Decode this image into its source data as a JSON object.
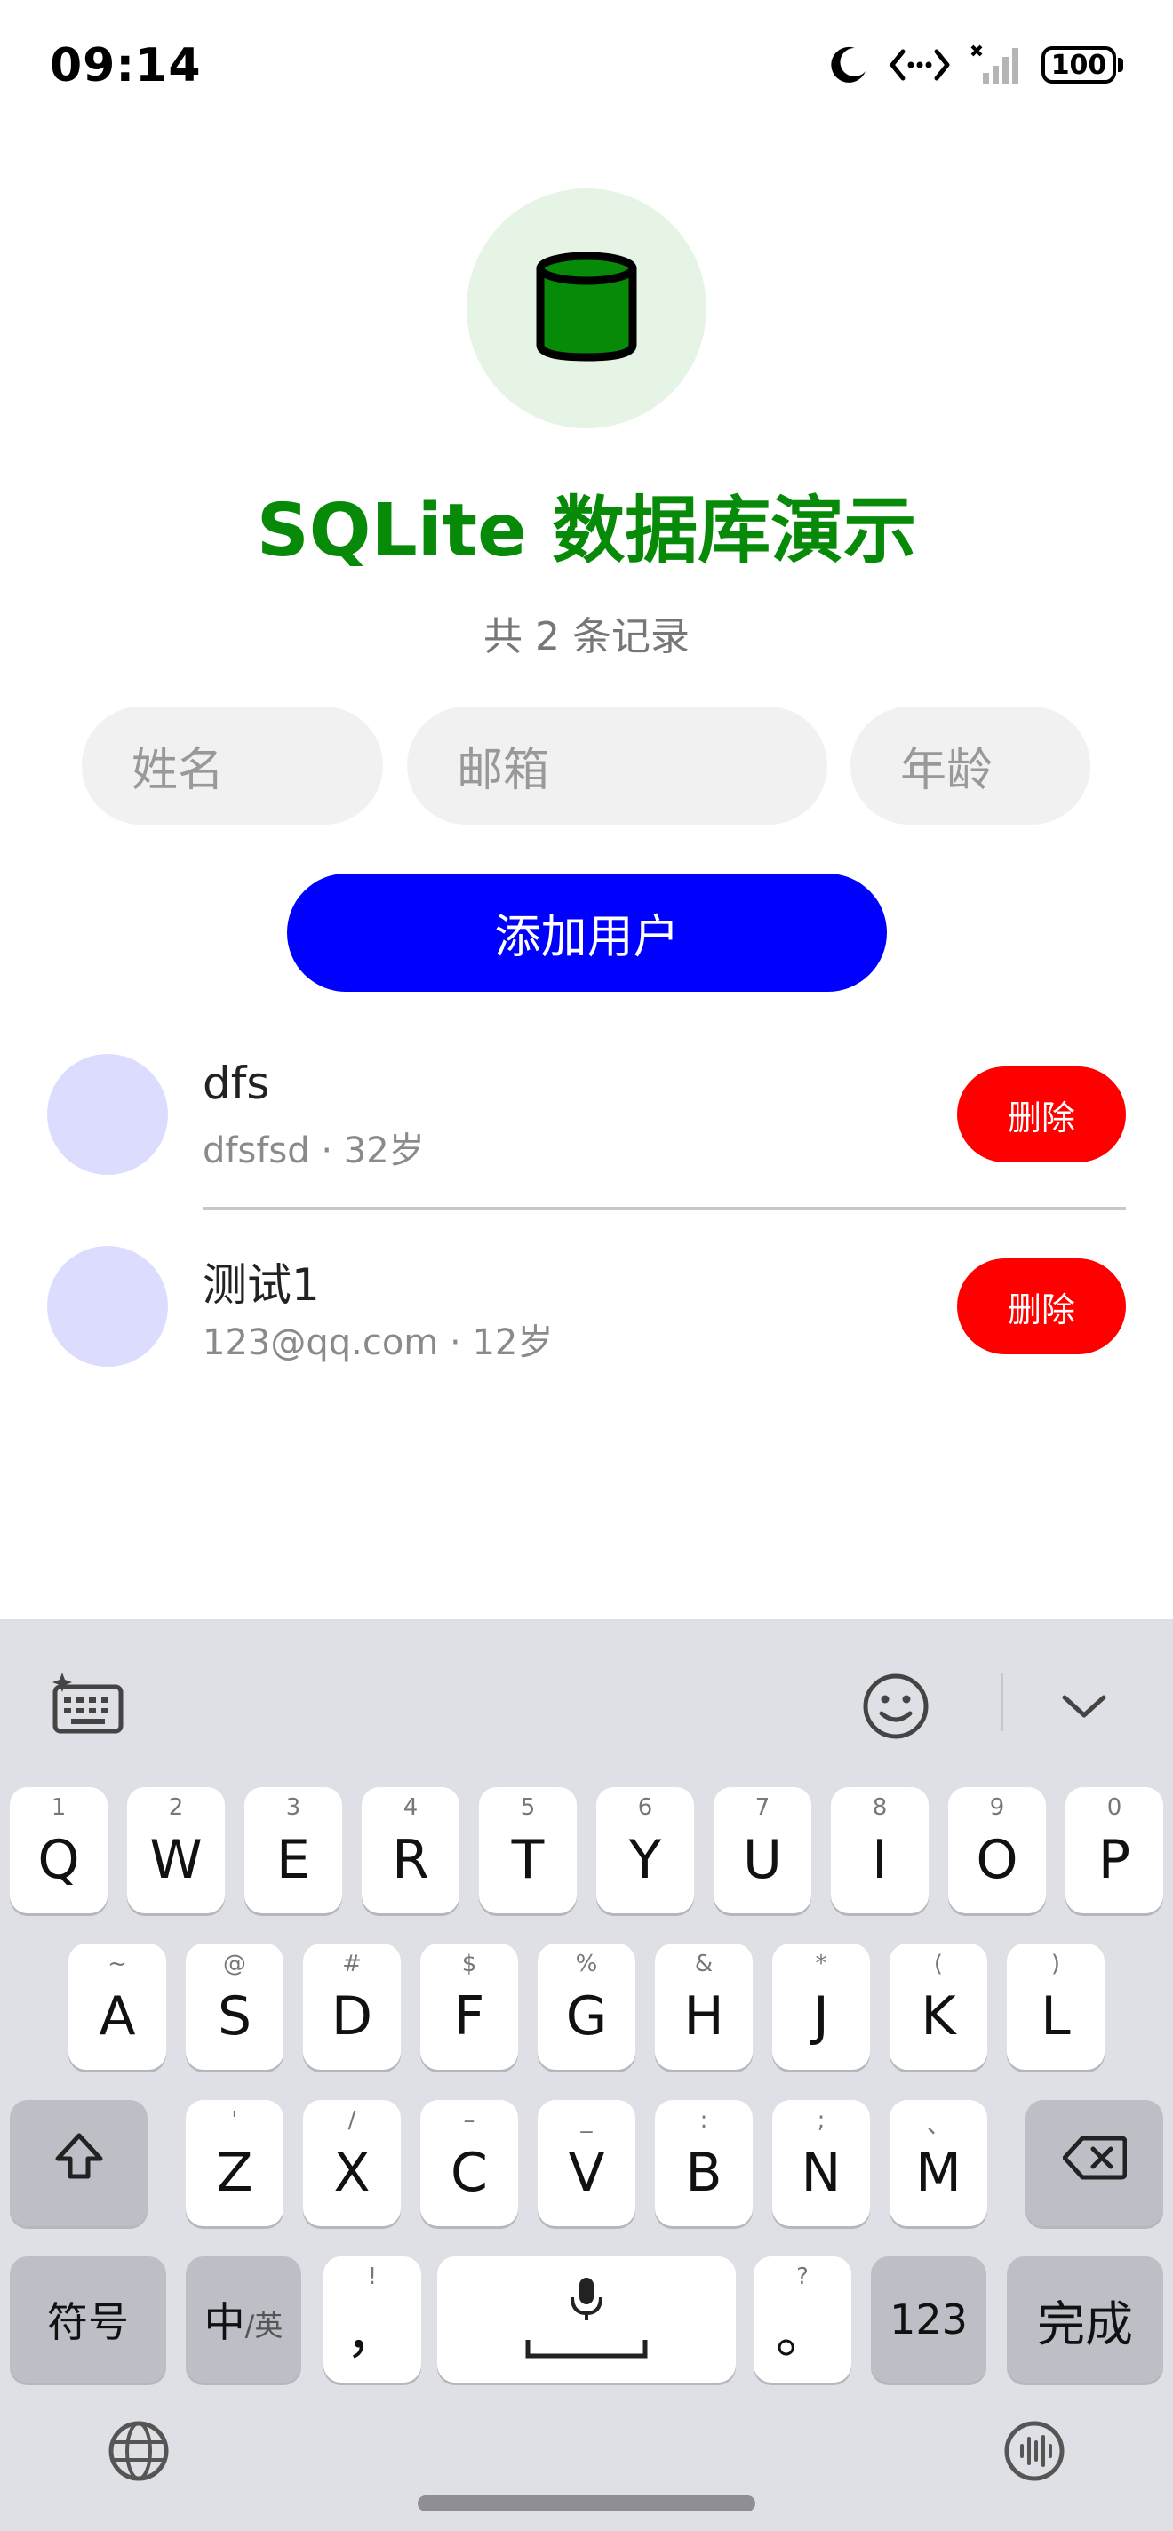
{
  "status_bar": {
    "time": "09:14",
    "battery": "100",
    "icons": [
      "moon-icon",
      "data-transfer-icon",
      "signal-icon",
      "battery-icon"
    ]
  },
  "header": {
    "logo_icon": "database-icon",
    "title": "SQLite 数据库演示",
    "record_count": "共 2 条记录",
    "title_color": "#078a07"
  },
  "form": {
    "name_placeholder": "姓名",
    "email_placeholder": "邮箱",
    "age_placeholder": "年龄",
    "add_label": "添加用户",
    "add_color": "#0000ff"
  },
  "users": [
    {
      "name": "dfs",
      "email": "dfsfsd",
      "age": "32岁",
      "delete_label": "删除"
    },
    {
      "name": "测试1",
      "email": "123@qq.com",
      "age": "12岁",
      "delete_label": "删除"
    }
  ],
  "meta_separator": "·",
  "keyboard": {
    "row1": [
      {
        "key": "Q",
        "hint": "1"
      },
      {
        "key": "W",
        "hint": "2"
      },
      {
        "key": "E",
        "hint": "3"
      },
      {
        "key": "R",
        "hint": "4"
      },
      {
        "key": "T",
        "hint": "5"
      },
      {
        "key": "Y",
        "hint": "6"
      },
      {
        "key": "U",
        "hint": "7"
      },
      {
        "key": "I",
        "hint": "8"
      },
      {
        "key": "O",
        "hint": "9"
      },
      {
        "key": "P",
        "hint": "0"
      }
    ],
    "row2": [
      {
        "key": "A",
        "hint": "~"
      },
      {
        "key": "S",
        "hint": "@"
      },
      {
        "key": "D",
        "hint": "#"
      },
      {
        "key": "F",
        "hint": "$"
      },
      {
        "key": "G",
        "hint": "%"
      },
      {
        "key": "H",
        "hint": "&"
      },
      {
        "key": "J",
        "hint": "*"
      },
      {
        "key": "K",
        "hint": "("
      },
      {
        "key": "L",
        "hint": ")"
      }
    ],
    "row3": [
      {
        "key": "Z",
        "hint": "'"
      },
      {
        "key": "X",
        "hint": "/"
      },
      {
        "key": "C",
        "hint": "–"
      },
      {
        "key": "V",
        "hint": "_"
      },
      {
        "key": "B",
        "hint": ":"
      },
      {
        "key": "N",
        "hint": ";"
      },
      {
        "key": "M",
        "hint": "、"
      }
    ],
    "symbols_label": "符号",
    "lang_label_main": "中",
    "lang_label_alt": "/英",
    "comma_key": "，",
    "comma_hint": "!",
    "period_key": "。",
    "period_hint": "?",
    "num_label": "123",
    "done_label": "完成"
  }
}
